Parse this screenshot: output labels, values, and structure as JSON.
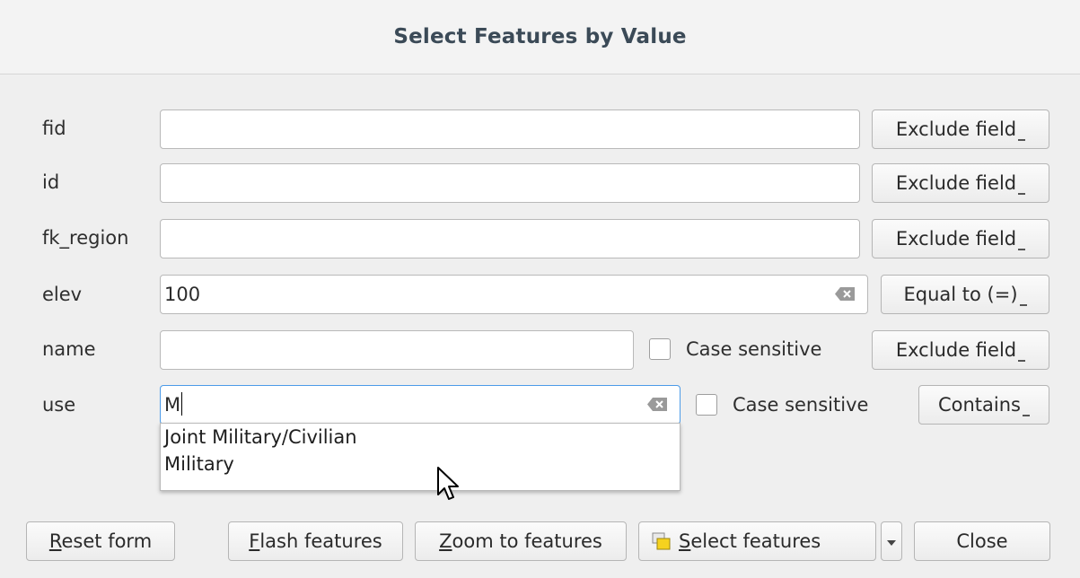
{
  "title": "Select Features by Value",
  "fields": [
    {
      "label": "fid",
      "value": "",
      "operator": "Exclude field"
    },
    {
      "label": "id",
      "value": "",
      "operator": "Exclude field"
    },
    {
      "label": "fk_region",
      "value": "",
      "operator": "Exclude field"
    },
    {
      "label": "elev",
      "value": "100",
      "operator": "Equal to (=)"
    },
    {
      "label": "name",
      "value": "",
      "case_label": "Case sensitive",
      "operator": "Exclude field"
    },
    {
      "label": "use",
      "value": "M",
      "case_label": "Case sensitive",
      "operator": "Contains"
    }
  ],
  "autocomplete": [
    "Joint Military/Civilian",
    "Military"
  ],
  "buttons": {
    "reset": {
      "u": "R",
      "rest": "eset form"
    },
    "flash": {
      "u": "F",
      "rest": "lash features"
    },
    "zoom": {
      "u": "Z",
      "rest": "oom to features"
    },
    "select": {
      "u": "S",
      "rest": "elect features"
    },
    "close": "Close"
  },
  "icons": {
    "clear": "backspace-clear-icon",
    "select": "select-features-icon",
    "cursor": "mouse-pointer-icon"
  },
  "colors": {
    "focus_border": "#4c9be8",
    "title_text": "#3b4a57"
  }
}
